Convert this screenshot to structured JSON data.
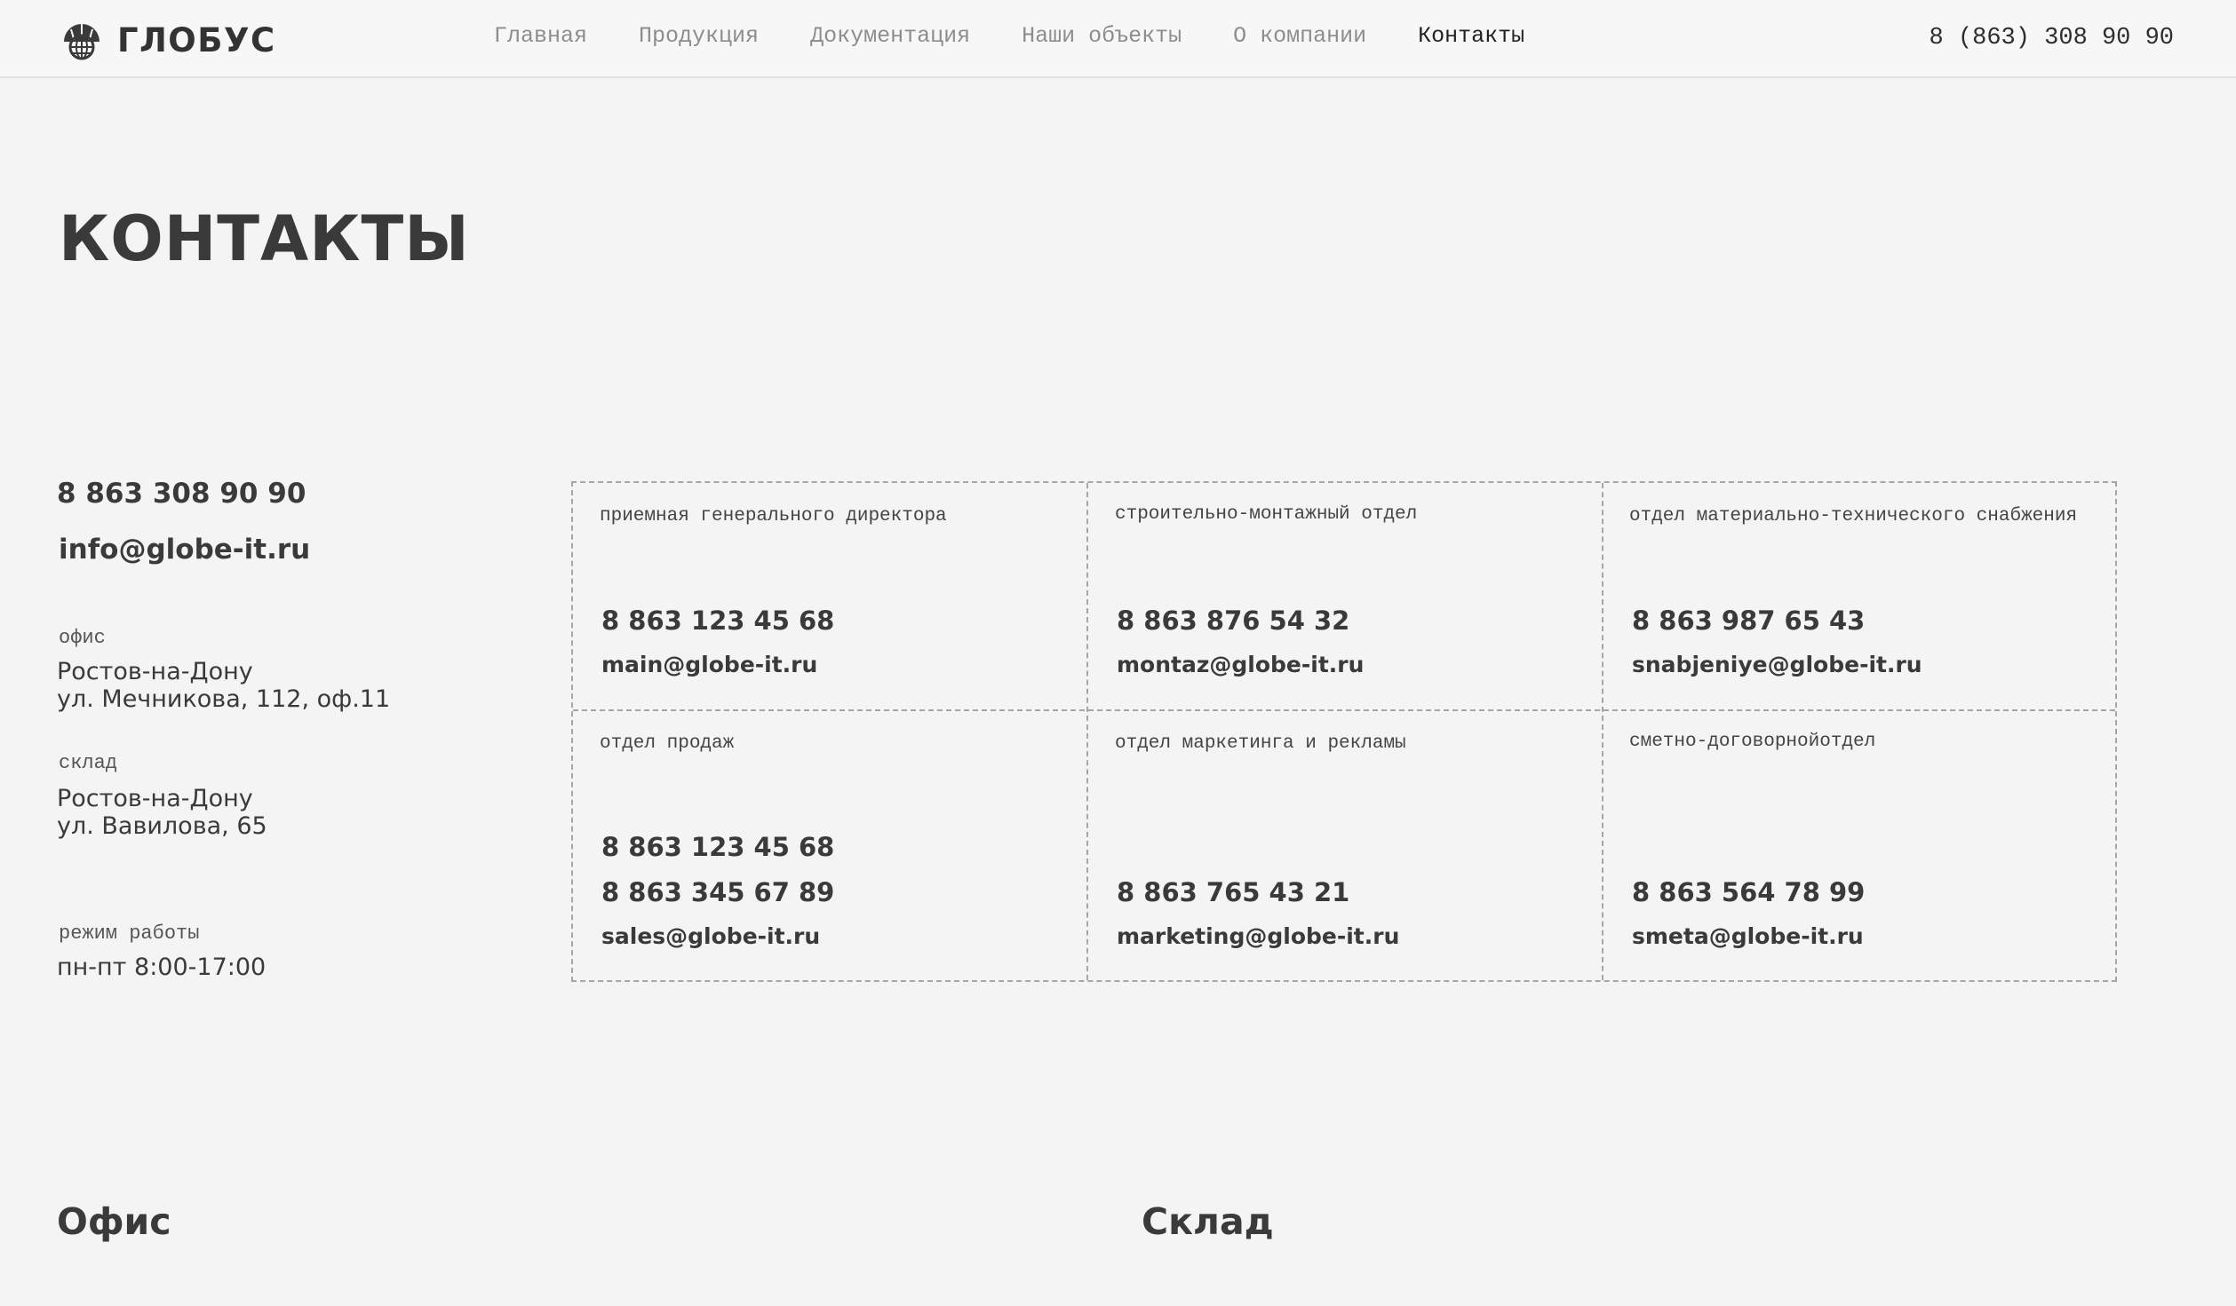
{
  "header": {
    "logo_text": "ГЛОБУС",
    "nav": [
      {
        "label": "Главная"
      },
      {
        "label": "Продукция"
      },
      {
        "label": "Документация"
      },
      {
        "label": "Наши объекты"
      },
      {
        "label": "О компании"
      },
      {
        "label": "Контакты",
        "active": true
      }
    ],
    "phone": "8 (863) 308 90 90"
  },
  "page_title": "КОНТАКТЫ",
  "info": {
    "phone": "8 863 308 90 90",
    "email": "info@globe-it.ru",
    "office_label": "офис",
    "office_city": "Ростов-на-Дону",
    "office_street": "ул. Мечникова, 112, оф.11",
    "warehouse_label": "склад",
    "warehouse_city": "Ростов-на-Дону",
    "warehouse_street": "ул. Вавилова, 65",
    "hours_label": "режим работы",
    "hours_value": "пн-пт 8:00-17:00"
  },
  "departments": [
    {
      "name": "приемная генерального директора",
      "phone": "8 863 123 45 68",
      "email": "main@globe-it.ru"
    },
    {
      "name": "строительно-монтажный отдел",
      "phone": "8 863 876 54 32",
      "email": "montaz@globe-it.ru"
    },
    {
      "name": "отдел материально-технического снабжения",
      "phone": "8 863 987 65 43",
      "email": "snabjeniye@globe-it.ru"
    },
    {
      "name": "отдел продаж",
      "phone": "8 863 123 45 68",
      "phone2": "8 863 345 67 89",
      "email": "sales@globe-it.ru"
    },
    {
      "name": "отдел маркетинга и рекламы",
      "phone": "8 863 765 43 21",
      "email": "marketing@globe-it.ru"
    },
    {
      "name": "сметно-договорнойотдел",
      "phone": "8 863 564 78 99",
      "email": "smeta@globe-it.ru"
    }
  ],
  "bottom": {
    "office_heading": "Офис",
    "warehouse_heading": "Склад"
  }
}
